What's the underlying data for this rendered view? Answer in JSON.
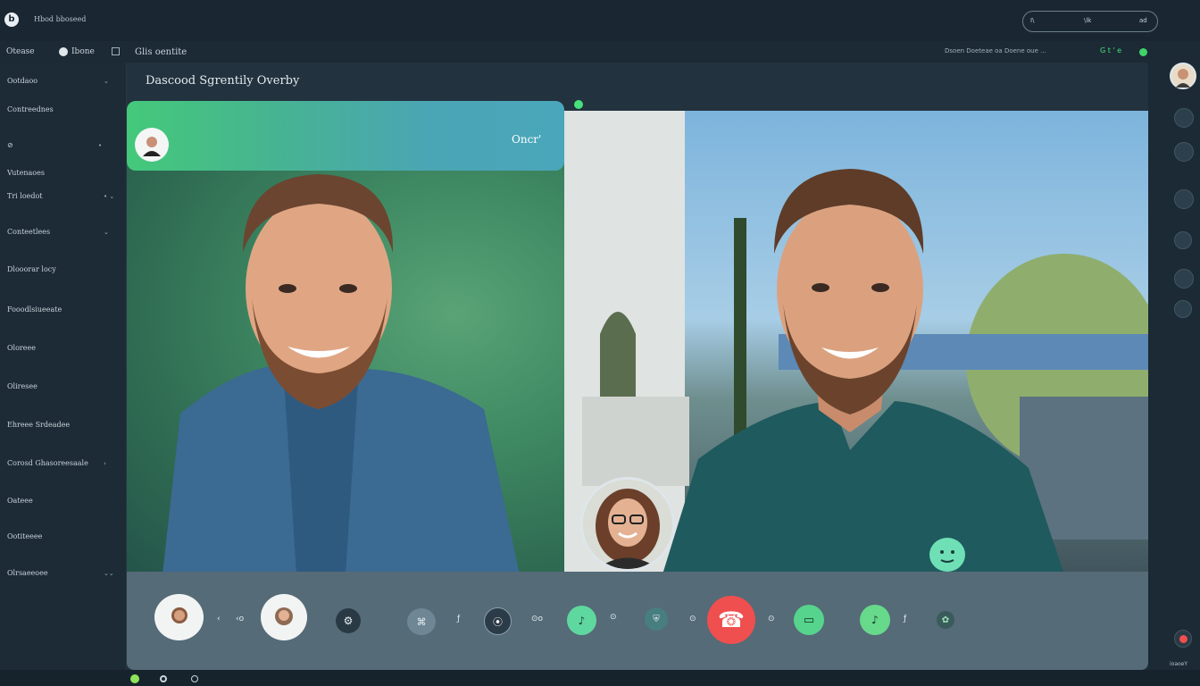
{
  "app": {
    "title": "Hbod bboseed",
    "logo_letter": "b"
  },
  "search": {
    "left_label": "I\\",
    "mid_label": "\\lk",
    "right_label": "ad"
  },
  "menu": {
    "item1": "Otease",
    "item2": "Ibone",
    "item3": "Glis oentite"
  },
  "status": {
    "text": "Dsoen Doeteae oa Doene oue  ...",
    "indicators": "G t ' e"
  },
  "sidebar": {
    "items": [
      {
        "label": "Ootdaoo",
        "arrow": "⌄"
      },
      {
        "label": "Contreednes"
      },
      {
        "label": "⊘",
        "arrow": "•"
      },
      {
        "label": "Vutenaoes"
      },
      {
        "label": "Tri loedot",
        "arrow": "• ⌄"
      },
      {
        "label": "Conteetlees",
        "arrow": "⌄"
      },
      {
        "label": "Dlooorar locy"
      },
      {
        "label": "Fooodlsiueeate"
      },
      {
        "label": "Oloreee"
      },
      {
        "label": "Oliresee"
      },
      {
        "label": "Ehreee Srdeadee"
      },
      {
        "label": "Corosd Ghasoreesaale",
        "arrow": "›"
      },
      {
        "label": "Oateee"
      },
      {
        "label": "Ootiteeee"
      },
      {
        "label": "Olrsaeeoee",
        "arrow": "⌄⌄"
      }
    ]
  },
  "main": {
    "title": "Dascood Sgrentily Overby",
    "left_tile": {
      "header_label": "Oncr'"
    }
  },
  "controls": {
    "labels": [
      "‹",
      "‹o",
      "ƒ",
      "⊙o",
      "⊙",
      "⊙",
      "⊙",
      "ƒ",
      "⊙"
    ],
    "end_call_glyph": "☎"
  },
  "colors": {
    "accent_green": "#4fd98d",
    "end_call": "#ef4f4f",
    "header_grad_start": "#44c97a",
    "header_grad_end": "#4aa6ba"
  },
  "footer": {
    "right_label": "ioaoeY"
  }
}
